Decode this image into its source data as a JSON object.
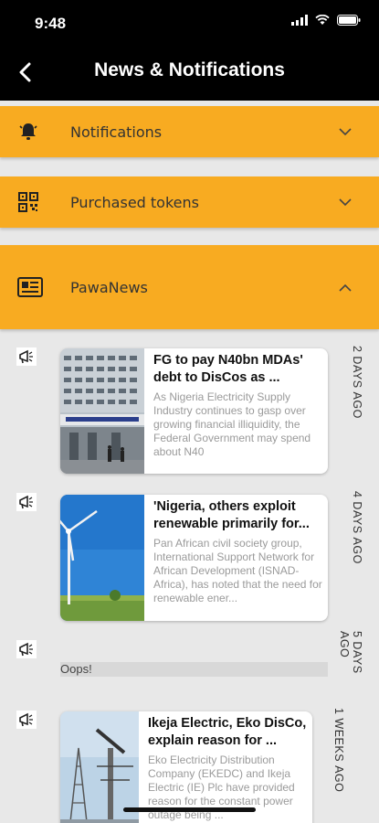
{
  "status_bar": {
    "time": "9:48"
  },
  "header": {
    "title": "News & Notifications"
  },
  "sections": [
    {
      "label": "Notifications",
      "icon": "bell-icon",
      "expanded": false
    },
    {
      "label": "Purchased tokens",
      "icon": "qr-code-icon",
      "expanded": false
    },
    {
      "label": "PawaNews",
      "icon": "newspaper-icon",
      "expanded": true
    }
  ],
  "news": [
    {
      "headline": "FG to pay N40bn MDAs' debt to DisCos as ...",
      "summary": "As Nigeria Electricity Supply Industry continues to gasp over growing financial illiquidity, the Federal Government may spend about N40",
      "ago_line1": "2 DAYS",
      "ago_line2": "AGO"
    },
    {
      "headline": "'Nigeria, others exploit renewable primarily for...",
      "summary": "Pan African civil society group, International Support Network for African Development (ISNAD-Africa), has noted that the need for renewable ener...",
      "ago_line1": "4 DAYS",
      "ago_line2": "AGO"
    },
    {
      "error": "Oops!",
      "ago_line1": "5 DAYS",
      "ago_line2": "AGO"
    },
    {
      "headline": "Ikeja Electric, Eko DisCo, explain reason for ...",
      "summary": "Eko Electricity Distribution Company (EKEDC) and Ikeja Electric (IE) Plc have provided reason for the constant power outage being ...",
      "ago_line1": "1 WEEKS",
      "ago_line2": "AGO"
    }
  ],
  "colors": {
    "accent": "#f8ab21",
    "header_bg": "#000000",
    "page_bg": "#e8e8e8"
  }
}
